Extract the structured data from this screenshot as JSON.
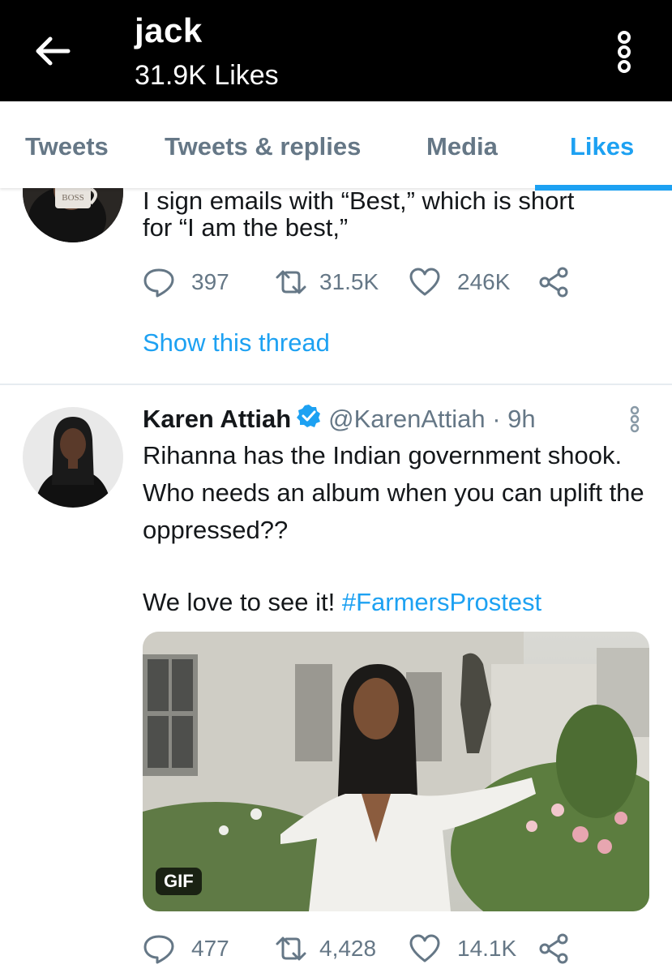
{
  "header": {
    "title": "jack",
    "subtitle": "31.9K Likes"
  },
  "tabs": [
    {
      "label": "Tweets",
      "active": false
    },
    {
      "label": "Tweets & replies",
      "active": false
    },
    {
      "label": "Media",
      "active": false
    },
    {
      "label": "Likes",
      "active": true
    }
  ],
  "tweet1": {
    "clipped_text": "I sign emails with “Best,” which is short",
    "text_line2": "for “I am the best,”",
    "avatar_mug_text": "BOSS",
    "replies": "397",
    "retweets": "31.5K",
    "likes": "246K",
    "show_thread": "Show this thread"
  },
  "tweet2": {
    "name": "Karen Attiah",
    "handle": "@KarenAttiah · 9h",
    "text": "Rihanna has the Indian government shook. Who needs an album when you can uplift the oppressed??",
    "text2_prefix": "We love to see it! ",
    "hashtag": "#FarmersProstest",
    "media_badge": "GIF",
    "replies": "477",
    "retweets": "4,428",
    "likes": "14.1K"
  },
  "colors": {
    "accent": "#1da1f2",
    "header_bg": "#000000",
    "muted": "#657786"
  }
}
